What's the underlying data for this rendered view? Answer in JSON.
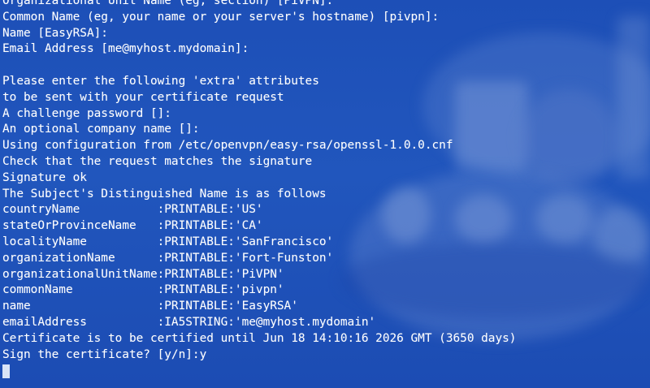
{
  "terminal": {
    "lines": [
      "Organizational Unit Name (eg, section) [PiVPN]:",
      "Common Name (eg, your name or your server's hostname) [pivpn]:",
      "Name [EasyRSA]:",
      "Email Address [me@myhost.mydomain]:",
      "",
      "Please enter the following 'extra' attributes",
      "to be sent with your certificate request",
      "A challenge password []:",
      "An optional company name []:",
      "Using configuration from /etc/openvpn/easy-rsa/openssl-1.0.0.cnf",
      "Check that the request matches the signature",
      "Signature ok",
      "The Subject's Distinguished Name is as follows",
      "countryName           :PRINTABLE:'US'",
      "stateOrProvinceName   :PRINTABLE:'CA'",
      "localityName          :PRINTABLE:'SanFrancisco'",
      "organizationName      :PRINTABLE:'Fort-Funston'",
      "organizationalUnitName:PRINTABLE:'PiVPN'",
      "commonName            :PRINTABLE:'pivpn'",
      "name                  :PRINTABLE:'EasyRSA'",
      "emailAddress          :IA5STRING:'me@myhost.mydomain'",
      "Certificate is to be certified until Jun 18 14:10:16 2026 GMT (3650 days)",
      "Sign the certificate? [y/n]:y"
    ]
  },
  "colors": {
    "background": "#1f52b8",
    "text": "#ffffff",
    "cursor": "#d9e4f7"
  }
}
